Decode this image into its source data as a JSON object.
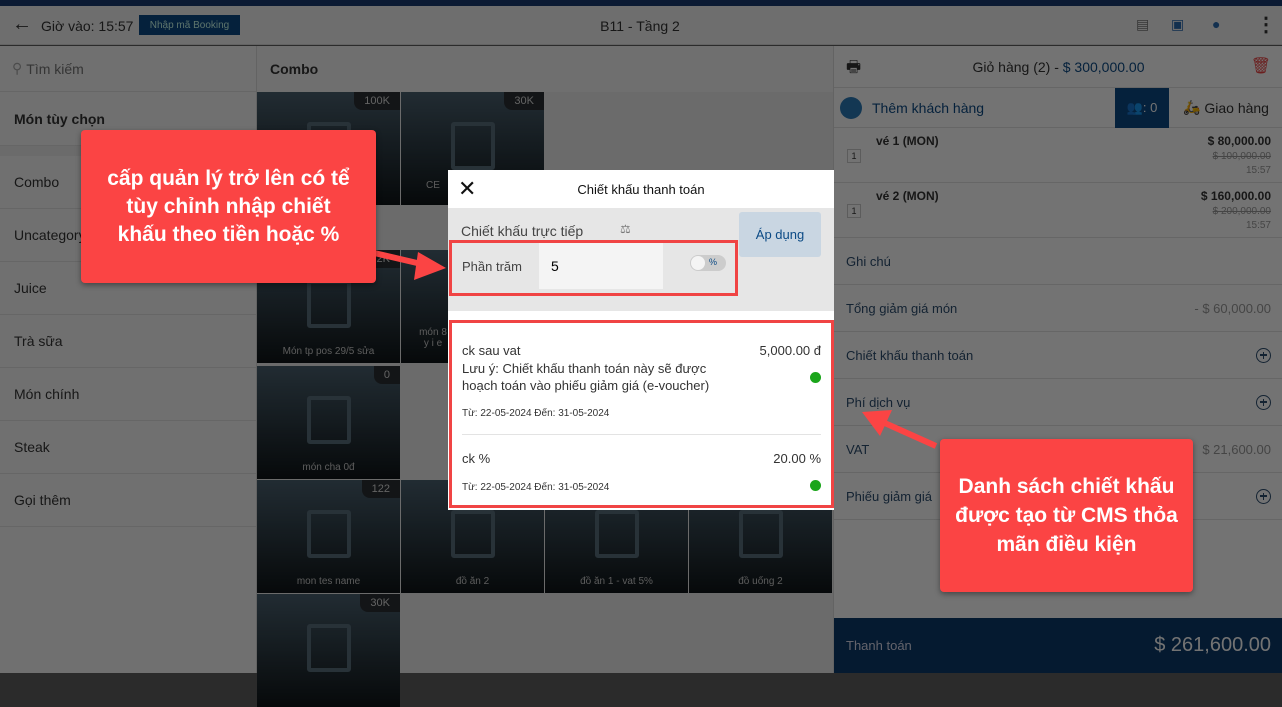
{
  "header": {
    "entry_time": "Giờ vào: 15:57",
    "booking_button": "Nhập mã Booking",
    "table_title": "B11 - Tầng 2"
  },
  "search": {
    "placeholder": "Tìm kiếm"
  },
  "categories": [
    "Món tùy chọn",
    "Combo",
    "Uncategory",
    "Juice",
    "Trà sữa",
    "Món chính",
    "Steak",
    "Gọi thêm"
  ],
  "grid": {
    "title": "Combo",
    "tiles": [
      {
        "badge": "100K",
        "label": ""
      },
      {
        "badge": "30K",
        "label": "CE"
      },
      {
        "badge": "2K",
        "label": "Món tp pos 29/5 sửa"
      },
      {
        "badge": "",
        "label": "món 8 y i e"
      },
      {
        "badge": "0",
        "label": "món cha 0đ"
      },
      {
        "badge": "122",
        "label": "mon tes name"
      },
      {
        "badge": "",
        "label": "đồ ăn 2"
      },
      {
        "badge": "",
        "label": "đồ ăn 1 - vat 5%"
      },
      {
        "badge": "",
        "label": "đồ uống 2"
      },
      {
        "badge": "30K",
        "label": ""
      }
    ]
  },
  "cart": {
    "title": "Giỏ hàng (2) - ",
    "total": "$ 300,000.00",
    "add_customer": "Thêm khách hàng",
    "guests": ": 0",
    "delivery": "Giao hàng",
    "items": [
      {
        "qty": "1",
        "name": "vé 1 (MON)",
        "price": "$ 80,000.00",
        "old_price": "$ 100,000.00",
        "time": "15:57"
      },
      {
        "qty": "1",
        "name": "vé 2 (MON)",
        "price": "$ 160,000.00",
        "old_price": "$ 200,000.00",
        "time": "15:57"
      }
    ],
    "note": "Ghi chú",
    "item_discount_label": "Tổng giảm giá món",
    "item_discount": "- $ 60,000.00",
    "payment_discount": "Chiết khấu thanh toán",
    "service_fee": "Phí dịch vụ",
    "vat_label": "VAT",
    "vat": "$ 21,600.00",
    "voucher": "Phiếu giảm giá",
    "pay_label": "Thanh toán",
    "pay_total": "$ 261,600.00"
  },
  "modal": {
    "title": "Chiết khấu thanh toán",
    "direct_label": "Chiết khấu trực tiếp",
    "apply": "Áp dụng",
    "percent_label": "Phần trăm",
    "percent_value": "5",
    "toggle_label": "%",
    "toggle_on": false,
    "discounts": [
      {
        "name": "ck sau vat",
        "value": "5,000.00 đ",
        "note": "Lưu ý: Chiết khấu thanh toán này sẽ được hoạch toán vào phiếu giảm giá (e-voucher)",
        "dates": "Từ: 22-05-2024 Đến: 31-05-2024"
      },
      {
        "name": "ck %",
        "value": "20.00 %",
        "note": "",
        "dates": "Từ: 22-05-2024 Đến: 31-05-2024"
      }
    ]
  },
  "annotations": {
    "left": "cấp quản lý trở lên có tể tùy chỉnh nhập chiết khấu theo tiền hoặc %",
    "right": "Danh sách chiết khấu được tạo từ CMS thỏa mãn điều kiện"
  },
  "colors": {
    "accent": "#0b4a85",
    "annotation": "#fb4444",
    "active_dot": "#1aa51a"
  }
}
